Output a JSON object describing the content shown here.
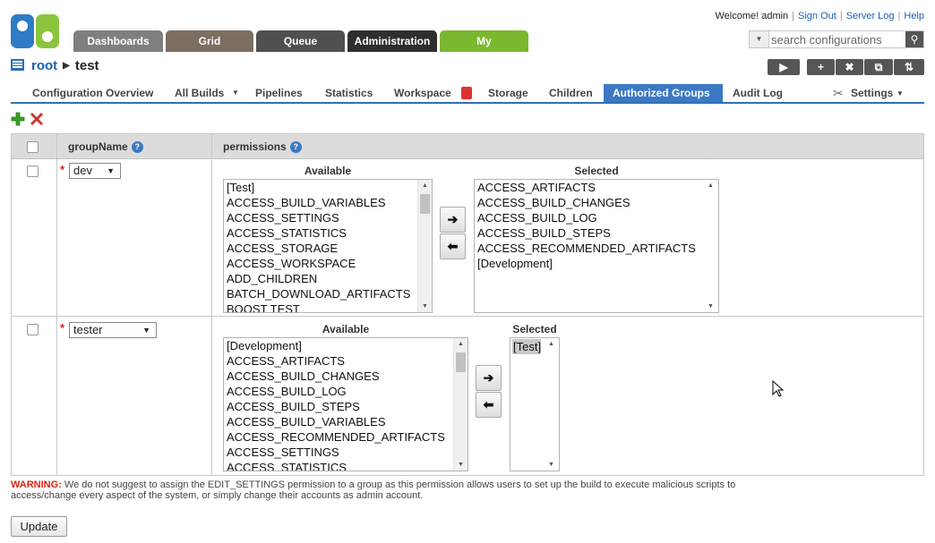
{
  "header": {
    "welcome": "Welcome! admin",
    "sign_out": "Sign Out",
    "server_log": "Server Log",
    "help": "Help",
    "search_placeholder": "search configurations"
  },
  "main_tabs": [
    {
      "label": "Dashboards",
      "color": "#7f7f7f"
    },
    {
      "label": "Grid",
      "color": "#7d6e62"
    },
    {
      "label": "Queue",
      "color": "#505050"
    },
    {
      "label": "Administration",
      "color": "#2e2e2e"
    },
    {
      "label": "My",
      "color": "#7ab82f"
    }
  ],
  "breadcrumb": {
    "root": "root",
    "current": "test"
  },
  "action_buttons": [
    "▶",
    "+",
    "✖",
    "⧉",
    "⇅"
  ],
  "subnav": [
    {
      "label": "Configuration Overview"
    },
    {
      "label": "All Builds"
    },
    {
      "label": "Pipelines"
    },
    {
      "label": "Statistics"
    },
    {
      "label": "Workspace"
    },
    {
      "label": "Storage"
    },
    {
      "label": "Children"
    },
    {
      "label": "Authorized Groups",
      "active": true
    },
    {
      "label": "Audit Log"
    },
    {
      "label": "Settings"
    }
  ],
  "table": {
    "col_group": "groupName",
    "col_permissions": "permissions",
    "help_glyph": "?",
    "available_label": "Available",
    "selected_label": "Selected",
    "rows": [
      {
        "group": "dev",
        "available": [
          "[Test]",
          "ACCESS_BUILD_VARIABLES",
          "ACCESS_SETTINGS",
          "ACCESS_STATISTICS",
          "ACCESS_STORAGE",
          "ACCESS_WORKSPACE",
          "ADD_CHILDREN",
          "BATCH_DOWNLOAD_ARTIFACTS",
          "BOOST TEST"
        ],
        "selected": [
          "ACCESS_ARTIFACTS",
          "ACCESS_BUILD_CHANGES",
          "ACCESS_BUILD_LOG",
          "ACCESS_BUILD_STEPS",
          "ACCESS_RECOMMENDED_ARTIFACTS",
          "[Development]"
        ]
      },
      {
        "group": "tester",
        "available": [
          "[Development]",
          "ACCESS_ARTIFACTS",
          "ACCESS_BUILD_CHANGES",
          "ACCESS_BUILD_LOG",
          "ACCESS_BUILD_STEPS",
          "ACCESS_BUILD_VARIABLES",
          "ACCESS_RECOMMENDED_ARTIFACTS",
          "ACCESS_SETTINGS",
          "ACCESS_STATISTICS"
        ],
        "selected": [
          "[Test]"
        ]
      }
    ]
  },
  "warning": {
    "label": "WARNING:",
    "text": " We do not suggest to assign the EDIT_SETTINGS permission to a group as this permission allows users to set up the build to execute malicious scripts to access/change every aspect of the system, or simply change their accounts as admin account."
  },
  "update_button": "Update"
}
